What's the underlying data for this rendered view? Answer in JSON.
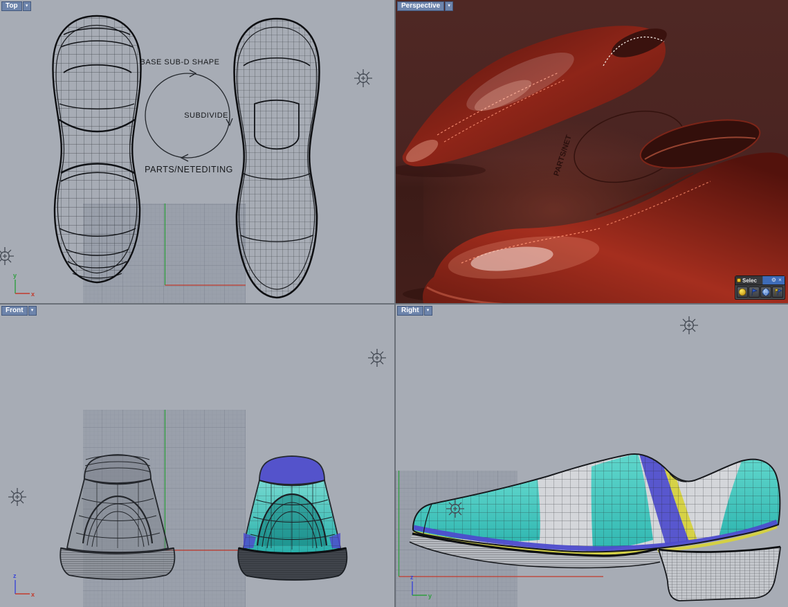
{
  "viewports": {
    "top": {
      "label": "Top"
    },
    "perspective": {
      "label": "Perspective"
    },
    "front": {
      "label": "Front"
    },
    "right": {
      "label": "Right"
    }
  },
  "icons": {
    "dropdown": "▾",
    "gear": "⚙",
    "close": "×"
  },
  "workflow": {
    "top_label": "BASE SUB-D SHAPE",
    "right_label": "SUBDIVIDE",
    "bottom_label": "PARTS/NETEDITING"
  },
  "perspective_scene": {
    "floor_text": "PARTS/NET"
  },
  "axes": {
    "x": "x",
    "y": "y",
    "z": "z"
  },
  "select_toolbar": {
    "title": "Selec"
  },
  "colors": {
    "viewport_bg": "#a7acb5",
    "grid_bg": "#9aa0ab",
    "perspective_bg": "#4a2420",
    "shoe_red": "#8c2418",
    "teal": "#38c9bd",
    "teal_dark": "#1fada7",
    "blue": "#4d4ccd",
    "yellow": "#d6d23f",
    "axis_x": "#c23a2c",
    "axis_y": "#2f9e3f",
    "axis_z": "#3a46d6",
    "tab_bg": "#6d84ab",
    "wire": "#17191d"
  }
}
